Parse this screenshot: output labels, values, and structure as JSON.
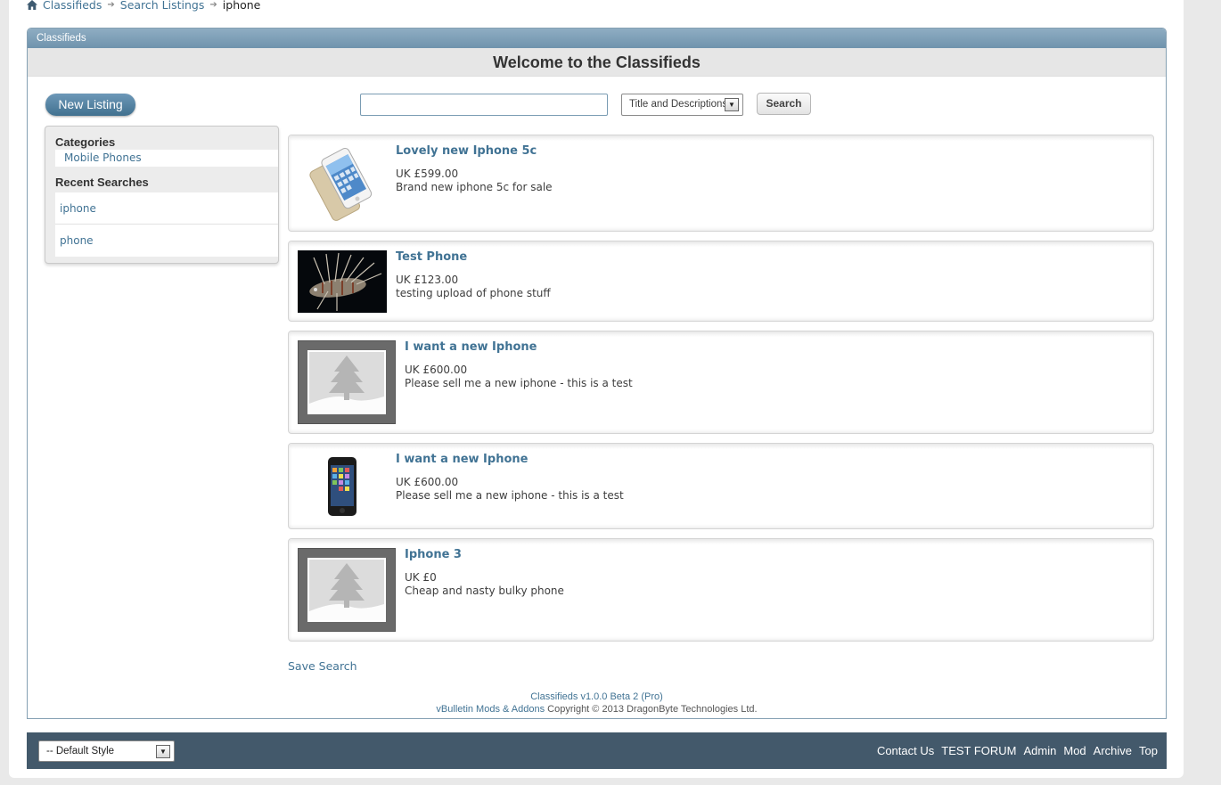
{
  "breadcrumb": {
    "items": [
      "Classifieds",
      "Search Listings"
    ],
    "current": "iphone"
  },
  "block": {
    "header": "Classifieds",
    "welcome": "Welcome to the Classifieds"
  },
  "toolbar": {
    "new_listing": "New Listing",
    "search_value": "",
    "search_scope": "Title and Descriptions",
    "search_button": "Search"
  },
  "sidebar": {
    "categories_title": "Categories",
    "categories": [
      "Mobile Phones"
    ],
    "recent_title": "Recent Searches",
    "recent": [
      "iphone",
      "phone"
    ]
  },
  "listings": [
    {
      "title": "Lovely new Iphone 5c",
      "price": "UK £599.00",
      "desc": "Brand new iphone 5c for sale",
      "image": "iphone-5c-photo"
    },
    {
      "title": "Test Phone",
      "price": "UK £123.00",
      "desc": "testing upload of phone stuff",
      "image": "lionfish-photo"
    },
    {
      "title": "I want a new Iphone",
      "price": "UK £600.00",
      "desc": "Please sell me a new iphone - this is a test",
      "image": "placeholder-image"
    },
    {
      "title": "I want a new Iphone",
      "price": "UK £600.00",
      "desc": "Please sell me a new iphone - this is a test",
      "image": "black-iphone-photo"
    },
    {
      "title": "Iphone 3",
      "price": "UK £0",
      "desc": "Cheap and nasty bulky phone",
      "image": "placeholder-image"
    }
  ],
  "save_search": "Save Search",
  "copyright": {
    "product": "Classifieds v1.0.0 Beta 2 (Pro)",
    "link": "vBulletin Mods & Addons",
    "rest": " Copyright © 2013 DragonByte Technologies Ltd."
  },
  "footer": {
    "style_select": "-- Default Style",
    "links": [
      "Contact Us",
      "TEST FORUM",
      "Admin",
      "Mod",
      "Archive",
      "Top"
    ]
  },
  "colors": {
    "link": "#417394",
    "header_bar": "#7b9db5",
    "footer_bar": "#43596b",
    "button": "#4f7d9c"
  }
}
